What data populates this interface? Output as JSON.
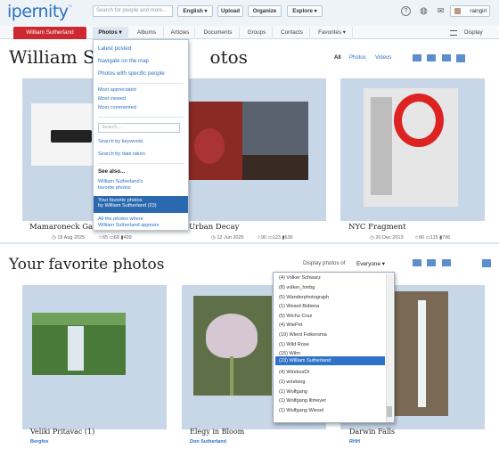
{
  "header": {
    "logo": "ipernity",
    "logo_tm": "™",
    "search_placeholder": "Search for people and more...",
    "language": "English ▾",
    "upload": "Upload",
    "organize": "Organize",
    "explore": "Explore ▾",
    "user": "raingirl"
  },
  "nav": {
    "user_tab": "William Sutherland",
    "items": [
      "Photos ▾",
      "Albums",
      "Articles",
      "Documents",
      "Groups",
      "Contacts",
      "Favorites ▾"
    ],
    "display": "Display"
  },
  "photos_section": {
    "title": "William Sutherland's photos",
    "title_visible": "William Suth",
    "title_tail": "otos",
    "filters": [
      "All",
      "Photos",
      "Videos"
    ],
    "cards": [
      {
        "title": "Mamaroneck Garg",
        "date": "19 Aug 2025",
        "favs": "65",
        "comments": "68",
        "views": "409"
      },
      {
        "title": "Urban Decay",
        "date": "12 Jun 2025",
        "favs": "90",
        "comments": "123",
        "views": "636"
      },
      {
        "title": "NYC Fragment",
        "date": "20 Dec 2013",
        "favs": "90",
        "comments": "115",
        "views": "796"
      }
    ]
  },
  "photos_menu": {
    "latest": "Latest posted",
    "map": "Navigate on the map",
    "people": "Photos with specific people",
    "appreciated": "Most appreciated",
    "viewed": "Most viewed",
    "commented": "Most commented",
    "search_placeholder": "Search...",
    "by_keywords": "Search by keywords",
    "by_date": "Search by date taken",
    "see_also": "See also...",
    "fav_line1": "William Sutherland's",
    "fav_line2": "favorite photos",
    "your_fav_line1": "Your favorite photos",
    "your_fav_line2": "by William Sutherland (23)",
    "all_line1": "All the photos where",
    "all_line2": "William Sutherland appears"
  },
  "favorites_section": {
    "title": "Your favorite photos",
    "display_label": "Display photos of",
    "display_value": "Everyone ▾",
    "cards": [
      {
        "title": "Veliki Pritavac (1)",
        "owner": "Bergfex"
      },
      {
        "title": "Elegy in Bloom",
        "owner": "Don Sutherland"
      },
      {
        "title": "Darwin Falls",
        "owner": "RHH"
      }
    ]
  },
  "people_list": {
    "items": [
      "(4) Volker Schwarz",
      "(8) volker_hmbg",
      "(5) Wanderphotograph",
      "(1) Weard Bültena",
      "(5) Wicho Cruz",
      "(4) WiePet",
      "(19) Wierd Folkersma",
      "(1) Wild Rose",
      "(15) Wilm",
      "(23) William Sutherland",
      "(4) WindsorDi",
      "(1) wirsberg",
      "(1) Wolfgang",
      "(1) Wolfgang Illmeyer",
      "(1) Wolfgang Wiesel"
    ],
    "selected": "(23) William Sutherland"
  },
  "colors": {
    "brand_blue": "#2a72c2",
    "user_tab_red": "#cc2a30",
    "card_bg": "#c8d7e8",
    "selection_blue": "#2f73c8"
  }
}
